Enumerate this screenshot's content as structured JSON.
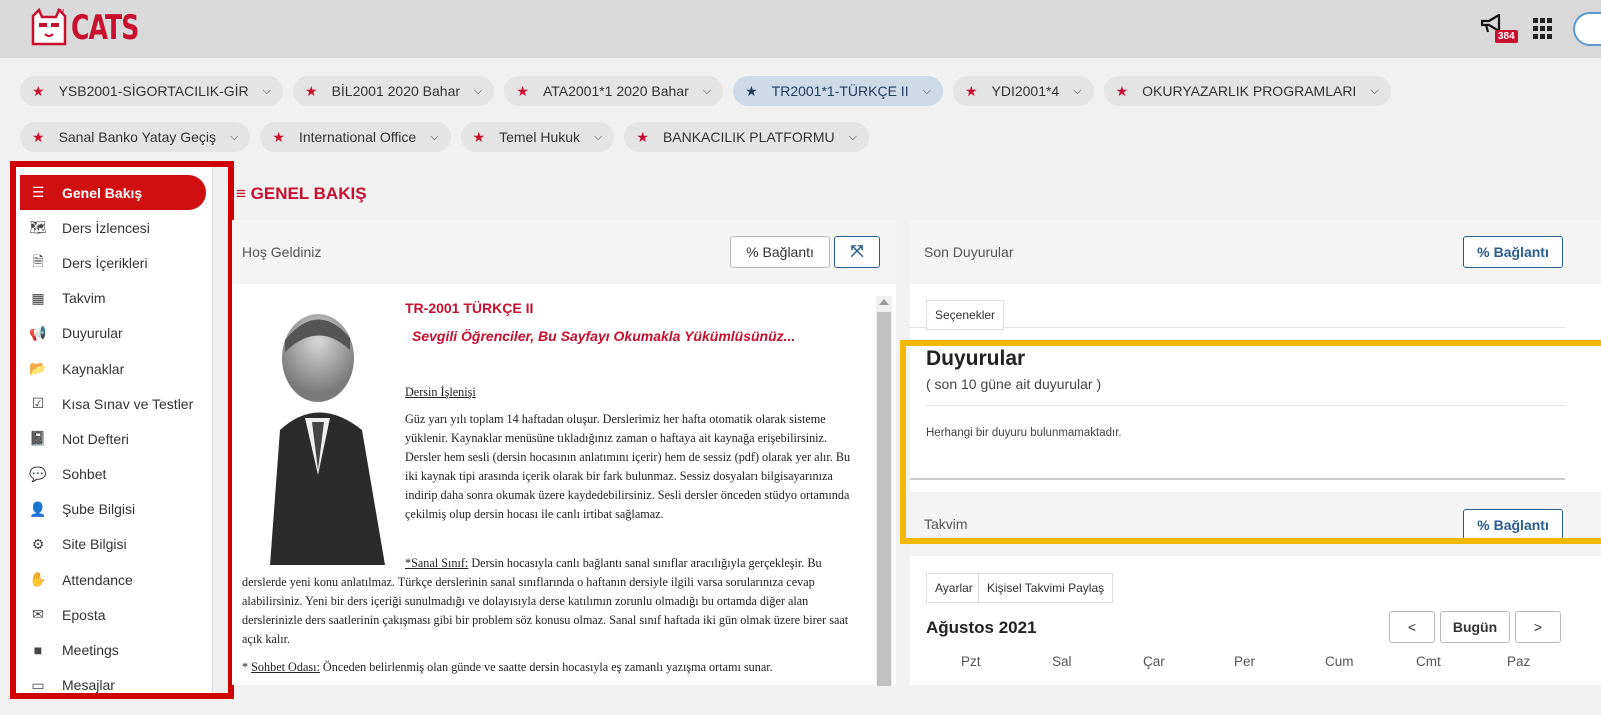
{
  "app": {
    "logo_text": "CATS",
    "logo_small": "ru",
    "notification_count": "384"
  },
  "course_tabs_row1": [
    {
      "label": "YSB2001-SİGORTACILIK-GİR",
      "active": false
    },
    {
      "label": "BİL2001 2020 Bahar",
      "active": false
    },
    {
      "label": "ATA2001*1 2020 Bahar",
      "active": false
    },
    {
      "label": "TR2001*1-TÜRKÇE II",
      "active": true
    },
    {
      "label": "YDI2001*4",
      "active": false
    },
    {
      "label": "OKURYAZARLIK PROGRAMLARI",
      "active": false
    }
  ],
  "course_tabs_row2": [
    {
      "label": "Sanal Banko Yatay Geçiş",
      "active": false
    },
    {
      "label": "International Office",
      "active": false
    },
    {
      "label": "Temel Hukuk",
      "active": false
    },
    {
      "label": "BANKACILIK PLATFORMU",
      "active": false
    }
  ],
  "sidebar": {
    "items": [
      {
        "label": "Genel Bakış",
        "icon": "list-icon",
        "glyph": "☰",
        "active": true
      },
      {
        "label": "Ders İzlencesi",
        "icon": "map-icon",
        "glyph": "🗺",
        "active": false
      },
      {
        "label": "Ders İçerikleri",
        "icon": "document-icon",
        "glyph": "🗎",
        "active": false
      },
      {
        "label": "Takvim",
        "icon": "calendar-icon",
        "glyph": "▦",
        "active": false
      },
      {
        "label": "Duyurular",
        "icon": "megaphone-icon",
        "glyph": "📢",
        "active": false
      },
      {
        "label": "Kaynaklar",
        "icon": "folder-icon",
        "glyph": "📂",
        "active": false
      },
      {
        "label": "Kısa Sınav ve Testler",
        "icon": "check-icon",
        "glyph": "☑",
        "active": false
      },
      {
        "label": "Not Defteri",
        "icon": "notebook-icon",
        "glyph": "📓",
        "active": false
      },
      {
        "label": "Sohbet",
        "icon": "chat-icon",
        "glyph": "💬",
        "active": false
      },
      {
        "label": "Şube Bilgisi",
        "icon": "user-icon",
        "glyph": "👤",
        "active": false
      },
      {
        "label": "Site Bilgisi",
        "icon": "gear-icon",
        "glyph": "⚙",
        "active": false
      },
      {
        "label": "Attendance",
        "icon": "hand-icon",
        "glyph": "✋",
        "active": false
      },
      {
        "label": "Eposta",
        "icon": "envelope-icon",
        "glyph": "✉",
        "active": false
      },
      {
        "label": "Meetings",
        "icon": "video-icon",
        "glyph": "■",
        "active": false
      },
      {
        "label": "Mesajlar",
        "icon": "message-icon",
        "glyph": "▭",
        "active": false
      }
    ]
  },
  "main": {
    "title_icon": "≡",
    "title": "GENEL BAKIŞ",
    "welcome": {
      "header": "Hoş Geldiniz",
      "link_button": "Bağlantı",
      "course_code": "TR-2001 TÜRKÇE II",
      "course_subtitle": "Sevgili Öğrenciler, Bu Sayfayı Okumakla Yükümlüsünüz...",
      "section_title": "Dersin İşlenişi",
      "para1": "Güz yarı yılı toplam 14 haftadan oluşur. Derslerimiz her hafta otomatik olarak sisteme yüklenir. Kaynaklar menüsüne tıkladığınız zaman o haftaya ait kaynağa erişebilirsiniz. Dersler hem sesli (dersin hocasının anlatımını içerir) hem de sessiz (pdf) olarak yer alır. Bu iki kaynak tipi arasında içerik olarak bir fark bulunmaz. Sessiz dosyaları bilgisayarınıza indirip daha sonra okumak üzere kaydedebilirsiniz. Sesli dersler önceden stüdyo ortamında çekilmiş olup dersin hocası ile canlı irtibat sağlamaz.",
      "para2_label": "*Sanal Sınıf:",
      "para2": " Dersin hocasıyla canlı bağlantı sanal sınıflar aracılığıyla gerçekleşir. Bu derslerde yeni konu anlatılmaz. Türkçe derslerinin sanal sınıflarında o haftanın dersiyle ilgili varsa sorularınıza cevap alabilirsiniz. Yeni bir ders içeriği sunulmadığı ve dolayısıyla derse katılımın zorunlu olmadığı bu ortamda diğer alan derslerinizle ders saatlerinin çakışması gibi bir problem söz konusu olmaz. Sanal sınıf haftada iki gün olmak üzere birer saat açık kalır.",
      "para3_prefix": "* ",
      "para3_label": "Sohbet Odası:",
      "para3": " Önceden belirlenmiş olan günde ve saatte dersin hocasıyla eş zamanlı yazışma ortamı sunar."
    },
    "announcements": {
      "header": "Son Duyurular",
      "link_button": "Bağlantı",
      "options_tab": "Seçenekler",
      "title": "Duyurular",
      "subtitle": "( son 10 güne ait duyurular )",
      "empty": "Herhangi bir duyuru bulunmamaktadır."
    },
    "calendar": {
      "header": "Takvim",
      "link_button": "Bağlantı",
      "tab_settings": "Ayarlar",
      "tab_share": "Kişisel Takvimi Paylaş",
      "month": "Ağustos 2021",
      "prev": "<",
      "today": "Bugün",
      "next": ">",
      "days": [
        "Pzt",
        "Sal",
        "Çar",
        "Per",
        "Cum",
        "Cmt",
        "Paz"
      ]
    }
  },
  "colors": {
    "brand_red": "#c8102e",
    "highlight_red": "#d00000",
    "highlight_yellow": "#f5b800",
    "active_tab": "#cddbe8"
  }
}
